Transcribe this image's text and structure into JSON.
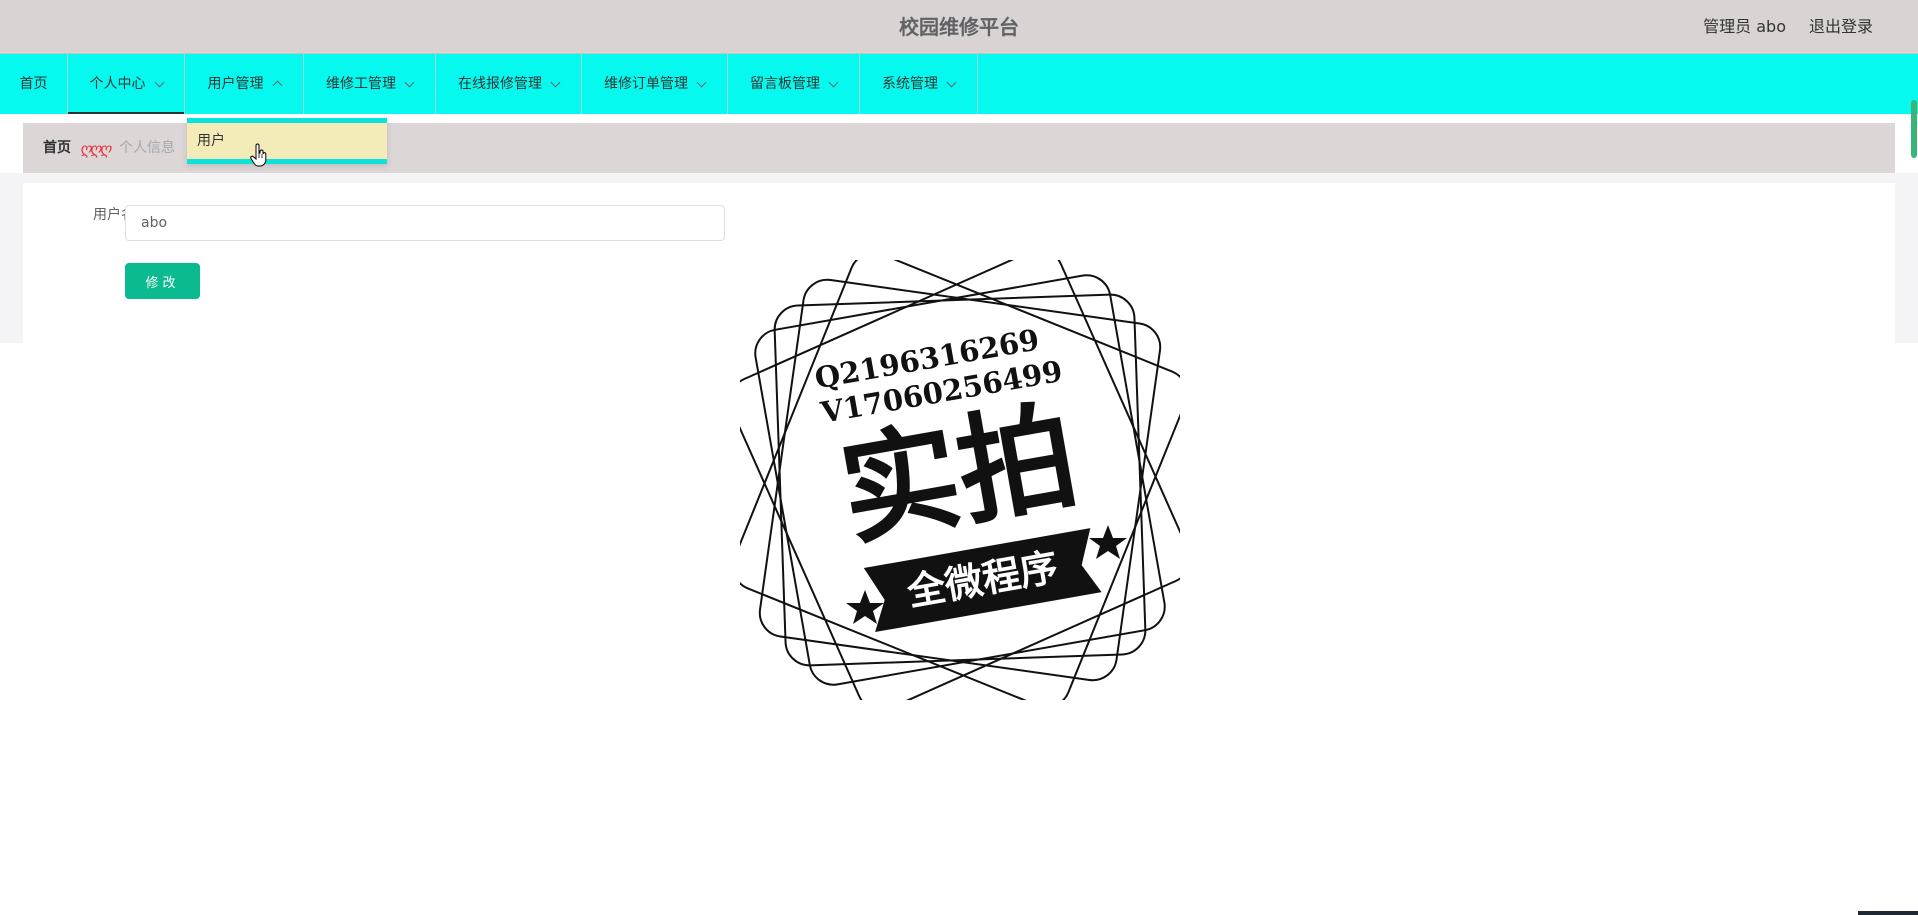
{
  "header": {
    "title": "校园维修平台",
    "user_label": "管理员 abo",
    "logout_label": "退出登录"
  },
  "nav": {
    "items": [
      {
        "label": "首页",
        "has_dropdown": false,
        "active": false
      },
      {
        "label": "个人中心",
        "has_dropdown": true,
        "active": true
      },
      {
        "label": "用户管理",
        "has_dropdown": true,
        "active": false,
        "open": true
      },
      {
        "label": "维修工管理",
        "has_dropdown": true,
        "active": false
      },
      {
        "label": "在线报修管理",
        "has_dropdown": true,
        "active": false
      },
      {
        "label": "维修订单管理",
        "has_dropdown": true,
        "active": false
      },
      {
        "label": "留言板管理",
        "has_dropdown": true,
        "active": false
      },
      {
        "label": "系统管理",
        "has_dropdown": true,
        "active": false
      }
    ],
    "dropdown_item": "用户"
  },
  "breadcrumb": {
    "home": "首页",
    "separator": "ღღღ",
    "current": "个人信息"
  },
  "form": {
    "username_label": "用户名",
    "username_value": "abo",
    "submit_label": "修改"
  },
  "watermark": {
    "line1": "Q2196316269",
    "line2": "V17060256499",
    "main_text": "实拍",
    "banner_text": "全微程序"
  },
  "colors": {
    "header_bg": "#d9d3d3",
    "nav_bg": "#05f9ef",
    "dropdown_bg": "#f3ecb9",
    "dropdown_border": "#0ce2dc",
    "button_bg": "#0cba90",
    "crumb_separator": "#e6323e"
  }
}
